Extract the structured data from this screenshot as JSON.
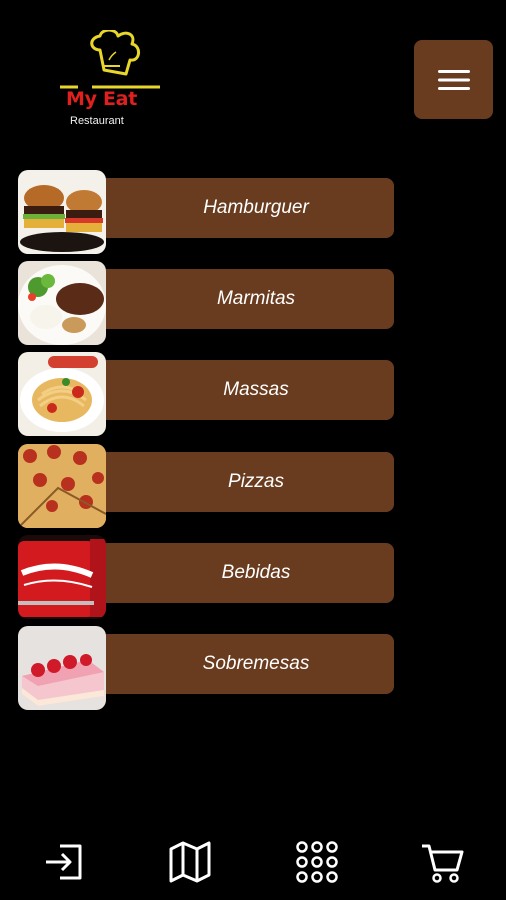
{
  "logo": {
    "brand_text": "My Eat",
    "subtitle": "Restaurant"
  },
  "header": {
    "menu_icon": "hamburger-menu-icon"
  },
  "categories": [
    {
      "label": "Hamburguer",
      "icon": "burger-photo"
    },
    {
      "label": "Marmitas",
      "icon": "marmita-photo"
    },
    {
      "label": "Massas",
      "icon": "pasta-photo"
    },
    {
      "label": "Pizzas",
      "icon": "pizza-photo"
    },
    {
      "label": "Bebidas",
      "icon": "drinks-photo"
    },
    {
      "label": "Sobremesas",
      "icon": "dessert-photo"
    }
  ],
  "bottom_nav": [
    {
      "icon": "login-icon"
    },
    {
      "icon": "map-icon"
    },
    {
      "icon": "grid-icon"
    },
    {
      "icon": "cart-icon"
    }
  ],
  "colors": {
    "background": "#000000",
    "accent": "#6a3c1f",
    "logo_text": "#e0201f",
    "logo_hat": "#e8d62a"
  }
}
